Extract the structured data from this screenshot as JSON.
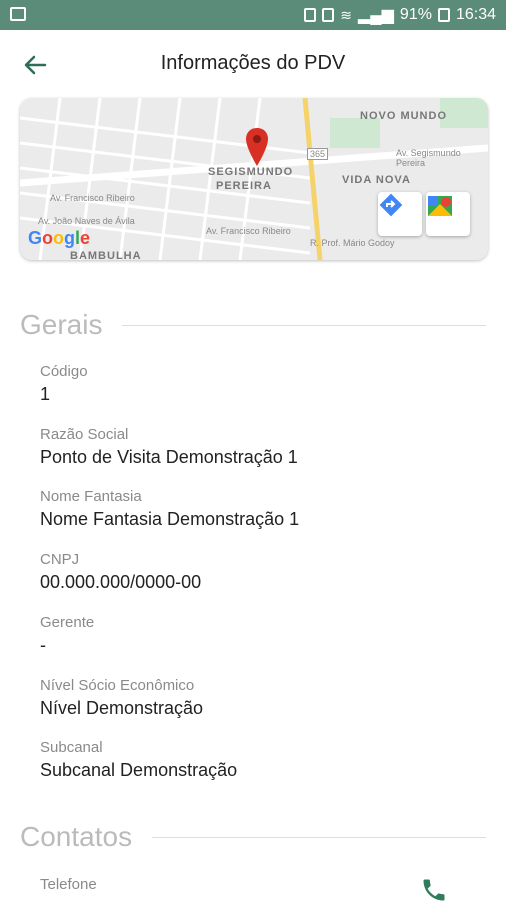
{
  "status_bar": {
    "battery_percent": "91%",
    "time": "16:34"
  },
  "header": {
    "title": "Informações do PDV",
    "back_icon": "arrow-back-icon"
  },
  "map": {
    "labels": [
      "NOVO MUNDO",
      "SEGISMUNDO",
      "PEREIRA",
      "VIDA NOVA",
      "BAMBULHA"
    ],
    "streets": [
      "Av. Segismundo Pereira",
      "Av. Francisco Ribeiro",
      "Av. João Naves de Ávila",
      "Av. Francisco Ribeiro",
      "R. Prof. Mário Godoy"
    ],
    "road_badge": "365",
    "google_logo": "Google",
    "buttons": {
      "directions_icon": "directions-icon",
      "maps_icon": "google-maps-icon"
    }
  },
  "sections": {
    "gerais": {
      "title": "Gerais",
      "fields": [
        {
          "label": "Código",
          "value": "1"
        },
        {
          "label": "Razão Social",
          "value": "Ponto de Visita Demonstração 1"
        },
        {
          "label": "Nome Fantasia",
          "value": "Nome Fantasia Demonstração 1"
        },
        {
          "label": "CNPJ",
          "value": "00.000.000/0000-00"
        },
        {
          "label": "Gerente",
          "value": "-"
        },
        {
          "label": "Nível Sócio Econômico",
          "value": "Nível Demonstração"
        },
        {
          "label": "Subcanal",
          "value": "Subcanal Demonstração"
        }
      ]
    },
    "contatos": {
      "title": "Contatos",
      "fields": [
        {
          "label": "Telefone",
          "value": ""
        }
      ]
    }
  },
  "colors": {
    "status_bar": "#5b8c79",
    "accent": "#2e7d5b",
    "pin": "#d93025",
    "directions": "#4285f4"
  }
}
